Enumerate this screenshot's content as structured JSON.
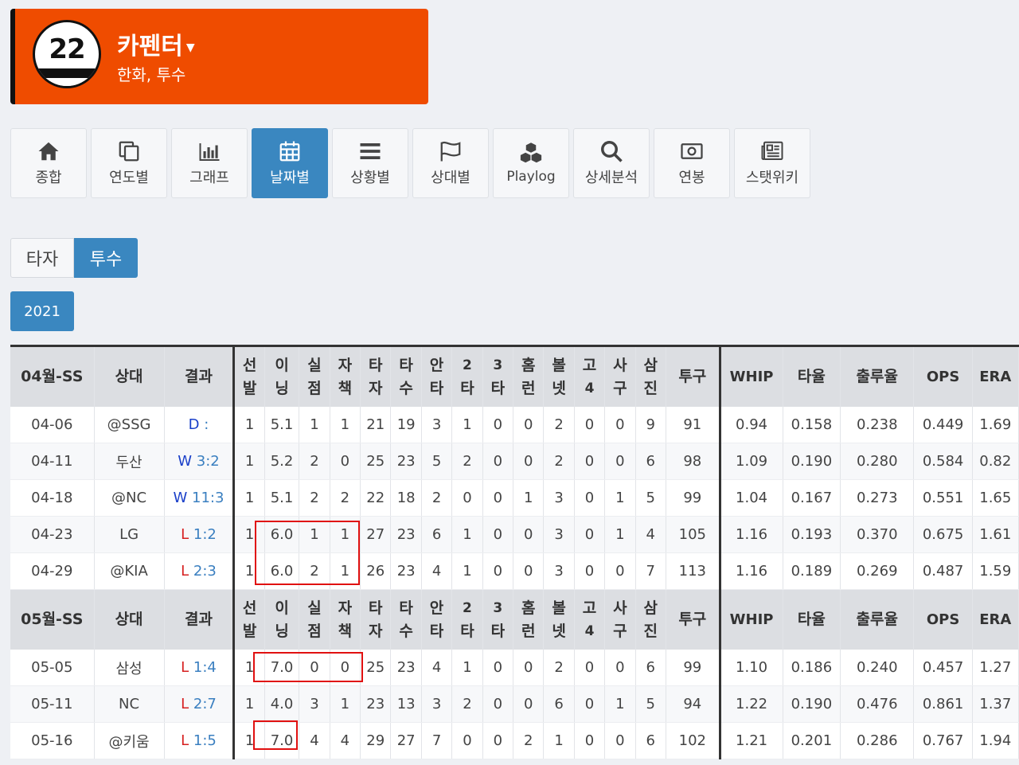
{
  "player": {
    "number": "22",
    "name": "카펜터",
    "sub": "한화, 투수"
  },
  "nav": [
    {
      "label": "종합",
      "icon": "home-icon"
    },
    {
      "label": "연도별",
      "icon": "copy-icon"
    },
    {
      "label": "그래프",
      "icon": "bar-chart-icon"
    },
    {
      "label": "날짜별",
      "icon": "calendar-icon",
      "active": true
    },
    {
      "label": "상황별",
      "icon": "list-icon"
    },
    {
      "label": "상대별",
      "icon": "flag-icon"
    },
    {
      "label": "Playlog",
      "icon": "cubes-icon"
    },
    {
      "label": "상세분석",
      "icon": "search-icon"
    },
    {
      "label": "연봉",
      "icon": "money-icon"
    },
    {
      "label": "스탯위키",
      "icon": "newspaper-icon"
    }
  ],
  "toggle": {
    "batter": "타자",
    "pitcher": "투수"
  },
  "year": "2021",
  "columns": {
    "opp": "상대",
    "result": "결과",
    "stats": [
      [
        "선",
        "발"
      ],
      [
        "이",
        "닝"
      ],
      [
        "실",
        "점"
      ],
      [
        "자",
        "책"
      ],
      [
        "타",
        "자"
      ],
      [
        "타",
        "수"
      ],
      [
        "안",
        "타"
      ],
      [
        "2",
        "타"
      ],
      [
        "3",
        "타"
      ],
      [
        "홈",
        "런"
      ],
      [
        "볼",
        "넷"
      ],
      [
        "고",
        "4"
      ],
      [
        "사",
        "구"
      ],
      [
        "삼",
        "진"
      ]
    ],
    "pitches": "투구",
    "whip": "WHIP",
    "avg": "타율",
    "obp": "출루율",
    "ops": "OPS",
    "era": "ERA"
  },
  "sections": [
    {
      "label": "04월-SS",
      "rows": [
        {
          "date": "04-06",
          "opp": "@SSG",
          "res": "D",
          "score": ":",
          "stats": [
            "1",
            "5.1",
            "1",
            "1",
            "21",
            "19",
            "3",
            "1",
            "0",
            "0",
            "2",
            "0",
            "0",
            "9"
          ],
          "pitches": "91",
          "whip": "0.94",
          "avg": "0.158",
          "obp": "0.238",
          "ops": "0.449",
          "era": "1.69"
        },
        {
          "date": "04-11",
          "opp": "두산",
          "res": "W",
          "score": "3:2",
          "stats": [
            "1",
            "5.2",
            "2",
            "0",
            "25",
            "23",
            "5",
            "2",
            "0",
            "0",
            "2",
            "0",
            "0",
            "6"
          ],
          "pitches": "98",
          "whip": "1.09",
          "avg": "0.190",
          "obp": "0.280",
          "ops": "0.584",
          "era": "0.82"
        },
        {
          "date": "04-18",
          "opp": "@NC",
          "res": "W",
          "score": "11:3",
          "stats": [
            "1",
            "5.1",
            "2",
            "2",
            "22",
            "18",
            "2",
            "0",
            "0",
            "1",
            "3",
            "0",
            "1",
            "5"
          ],
          "pitches": "99",
          "whip": "1.04",
          "avg": "0.167",
          "obp": "0.273",
          "ops": "0.551",
          "era": "1.65"
        },
        {
          "date": "04-23",
          "opp": "LG",
          "res": "L",
          "score": "1:2",
          "stats": [
            "1",
            "6.0",
            "1",
            "1",
            "27",
            "23",
            "6",
            "1",
            "0",
            "0",
            "3",
            "0",
            "1",
            "4"
          ],
          "pitches": "105",
          "whip": "1.16",
          "avg": "0.193",
          "obp": "0.370",
          "ops": "0.675",
          "era": "1.61"
        },
        {
          "date": "04-29",
          "opp": "@KIA",
          "res": "L",
          "score": "2:3",
          "stats": [
            "1",
            "6.0",
            "2",
            "1",
            "26",
            "23",
            "4",
            "1",
            "0",
            "0",
            "3",
            "0",
            "0",
            "7"
          ],
          "pitches": "113",
          "whip": "1.16",
          "avg": "0.189",
          "obp": "0.269",
          "ops": "0.487",
          "era": "1.59"
        }
      ]
    },
    {
      "label": "05월-SS",
      "rows": [
        {
          "date": "05-05",
          "opp": "삼성",
          "res": "L",
          "score": "1:4",
          "stats": [
            "1",
            "7.0",
            "0",
            "0",
            "25",
            "23",
            "4",
            "1",
            "0",
            "0",
            "2",
            "0",
            "0",
            "6"
          ],
          "pitches": "99",
          "whip": "1.10",
          "avg": "0.186",
          "obp": "0.240",
          "ops": "0.457",
          "era": "1.27"
        },
        {
          "date": "05-11",
          "opp": "NC",
          "res": "L",
          "score": "2:7",
          "stats": [
            "1",
            "4.0",
            "3",
            "1",
            "23",
            "13",
            "3",
            "2",
            "0",
            "0",
            "6",
            "0",
            "1",
            "5"
          ],
          "pitches": "94",
          "whip": "1.22",
          "avg": "0.190",
          "obp": "0.476",
          "ops": "0.861",
          "era": "1.37"
        },
        {
          "date": "05-16",
          "opp": "@키움",
          "res": "L",
          "score": "1:5",
          "stats": [
            "1",
            "7.0",
            "4",
            "4",
            "29",
            "27",
            "7",
            "0",
            "0",
            "2",
            "1",
            "0",
            "0",
            "6"
          ],
          "pitches": "102",
          "whip": "1.21",
          "avg": "0.201",
          "obp": "0.286",
          "ops": "0.767",
          "era": "1.94"
        }
      ]
    }
  ]
}
